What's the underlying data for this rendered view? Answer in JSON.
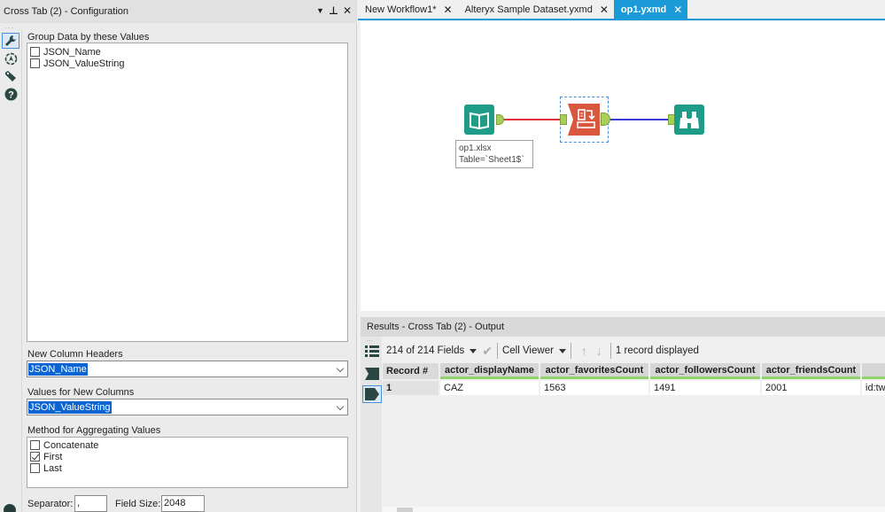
{
  "config_panel": {
    "title": "Cross Tab (2) - Configuration",
    "title_controls": [
      "dropdown-icon",
      "pin-icon",
      "close-icon"
    ],
    "side_icons": [
      "wrench-icon",
      "compass-icon",
      "tag-icon",
      "help-icon"
    ],
    "group_by": {
      "label": "Group Data by these Values",
      "items": [
        {
          "label": "JSON_Name",
          "checked": false
        },
        {
          "label": "JSON_ValueString",
          "checked": false
        }
      ]
    },
    "new_column_headers": {
      "label": "New Column Headers",
      "value": "JSON_Name"
    },
    "values_for_new_columns": {
      "label": "Values for New Columns",
      "value": "JSON_ValueString"
    },
    "aggregation": {
      "label": "Method for Aggregating Values",
      "items": [
        {
          "label": "Concatenate",
          "checked": false
        },
        {
          "label": "First",
          "checked": true
        },
        {
          "label": "Last",
          "checked": false
        }
      ]
    },
    "separator": {
      "label": "Separator:",
      "value": ","
    },
    "field_size": {
      "label": "Field Size:",
      "value": "2048"
    }
  },
  "tabs": [
    {
      "label": "New Workflow1*",
      "active": false
    },
    {
      "label": "Alteryx Sample Dataset.yxmd",
      "active": false
    },
    {
      "label": "op1.yxmd",
      "active": true
    }
  ],
  "canvas": {
    "tools": [
      {
        "name": "input-data-tool",
        "icon": "book-icon",
        "color": "#1f9c87"
      },
      {
        "name": "cross-tab-tool",
        "icon": "cross-tab-icon",
        "color": "#d9563f"
      },
      {
        "name": "browse-tool",
        "icon": "binoculars-icon",
        "color": "#1f9c87"
      }
    ],
    "annotation": {
      "line1": "op1.xlsx",
      "line2": "Table=`Sheet1$`"
    },
    "connection_colors": {
      "input_to_crosstab": "#e0303a",
      "crosstab_to_browse": "#3a3ad6"
    }
  },
  "results": {
    "title": "Results - Cross Tab (2) - Output",
    "fields_selector": "214 of 214 Fields",
    "viewer": "Cell Viewer",
    "record_count": "1 record displayed",
    "columns": [
      "Record #",
      "actor_displayName",
      "actor_favoritesCount",
      "actor_followersCount",
      "actor_friendsCount",
      ""
    ],
    "rows": [
      [
        "1",
        "CAZ",
        "1563",
        "1491",
        "2001",
        "id:twi"
      ]
    ]
  },
  "colors": {
    "accent": "#1a9bd7",
    "tool_green": "#1f9c87",
    "tool_orange": "#d9563f",
    "header_underline": "#8fd36a"
  }
}
